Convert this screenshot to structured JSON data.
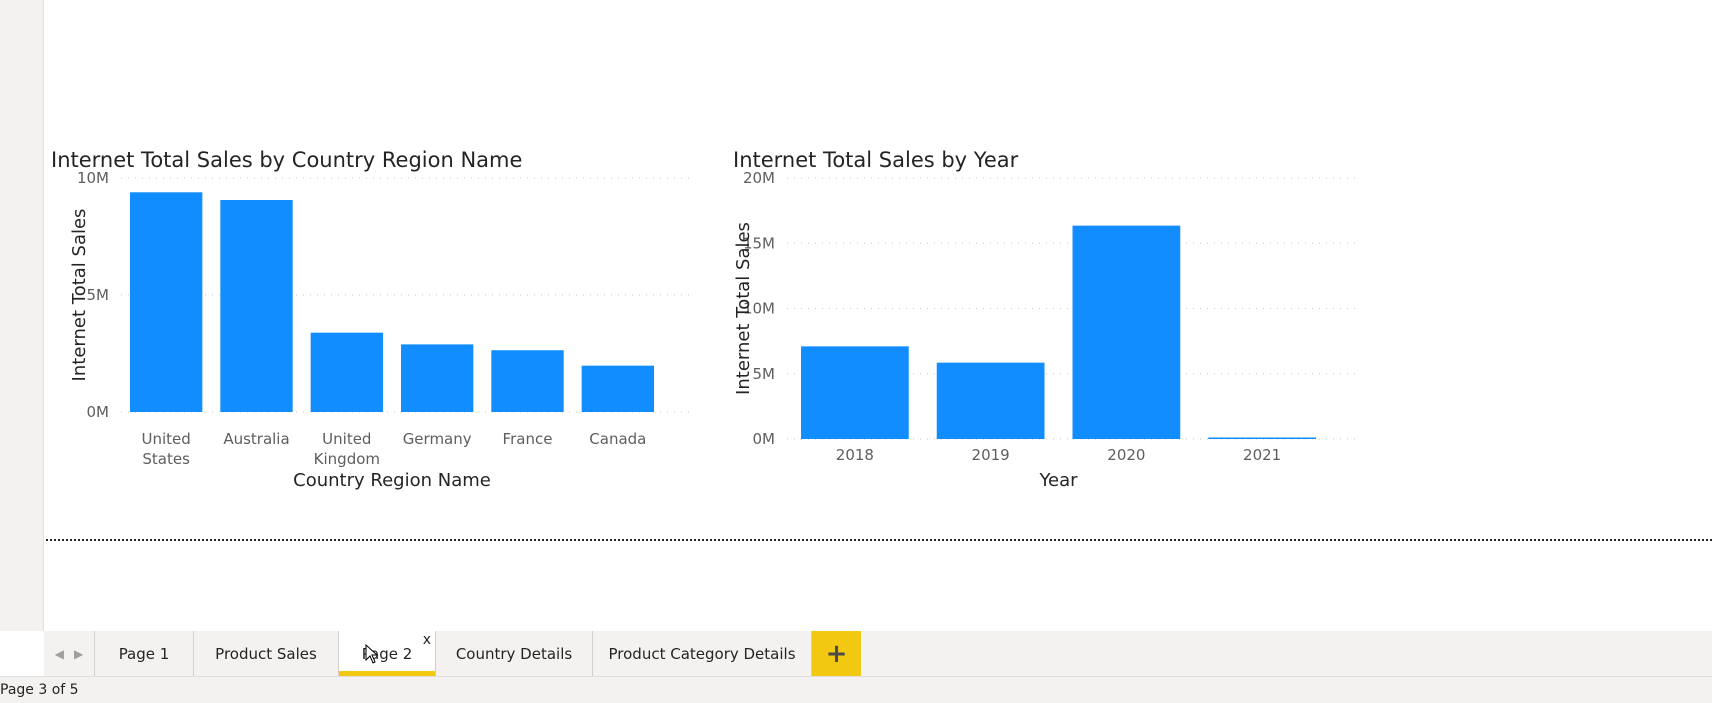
{
  "charts": [
    {
      "title": "Internet Total Sales by Country Region Name",
      "chart_data": {
        "type": "bar",
        "title": "Internet Total Sales by Country Region Name",
        "categories": [
          [
            "United",
            "States"
          ],
          [
            "Australia"
          ],
          [
            "United",
            "Kingdom"
          ],
          [
            "Germany"
          ],
          [
            "France"
          ],
          [
            "Canada"
          ]
        ],
        "values": [
          9390000,
          9060000,
          3390000,
          2890000,
          2640000,
          1980000
        ],
        "xlabel": "Country Region Name",
        "ylabel": "Internet Total Sales",
        "ylim": [
          0,
          10000000
        ],
        "yticks": [
          {
            "value": 0,
            "label": "0M"
          },
          {
            "value": 5000000,
            "label": "5M"
          },
          {
            "value": 10000000,
            "label": "10M"
          }
        ],
        "grid": true,
        "color": "#118dff"
      }
    },
    {
      "title": "Internet Total Sales by Year",
      "chart_data": {
        "type": "bar",
        "title": "Internet Total Sales by Year",
        "categories": [
          [
            "2018"
          ],
          [
            "2019"
          ],
          [
            "2020"
          ],
          [
            "2021"
          ]
        ],
        "values": [
          7100000,
          5850000,
          16350000,
          45000
        ],
        "xlabel": "Year",
        "ylabel": "Internet Total Sales",
        "ylim": [
          0,
          20000000
        ],
        "yticks": [
          {
            "value": 0,
            "label": "0M"
          },
          {
            "value": 5000000,
            "label": "5M"
          },
          {
            "value": 10000000,
            "label": "10M"
          },
          {
            "value": 15000000,
            "label": "15M"
          },
          {
            "value": 20000000,
            "label": "20M"
          }
        ],
        "grid": true,
        "color": "#118dff"
      }
    }
  ],
  "tabs": {
    "items": [
      {
        "label": "Page 1",
        "active": false
      },
      {
        "label": "Product Sales",
        "active": false
      },
      {
        "label": "Page 2",
        "active": true
      },
      {
        "label": "Country Details",
        "active": false
      },
      {
        "label": "Product Category Details",
        "active": false
      }
    ],
    "close_label": "x",
    "add_label": "+"
  },
  "status": {
    "page_indicator": "Page 3 of 5"
  }
}
